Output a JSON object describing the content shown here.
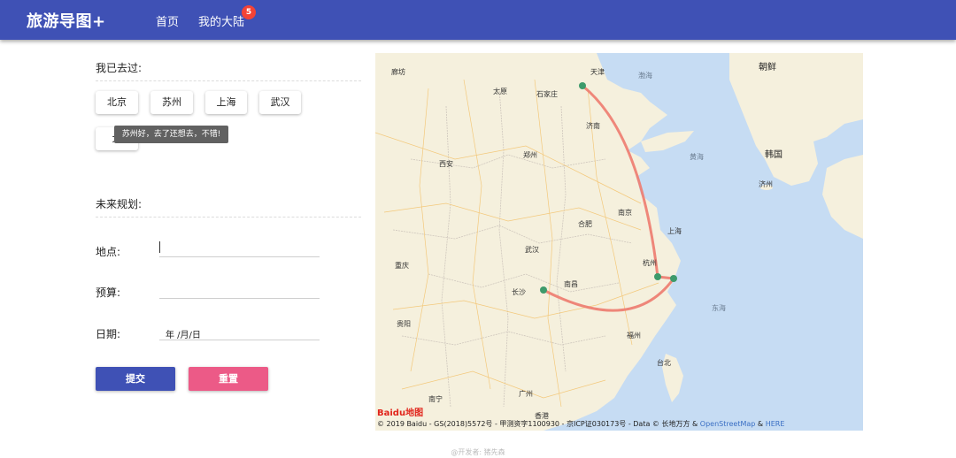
{
  "header": {
    "brand": "旅游导图+",
    "nav_home": "首页",
    "nav_mine": "我的大陆",
    "badge_count": "5"
  },
  "visited": {
    "title": "我已去过:",
    "cities": [
      "北京",
      "苏州",
      "上海",
      "武汉",
      "大"
    ],
    "tooltip": "苏州好，去了还想去，不错!"
  },
  "plan": {
    "title": "未来规划:",
    "location_label": "地点:",
    "budget_label": "预算:",
    "date_label": "日期:",
    "date_placeholder": "年 /月/日"
  },
  "actions": {
    "submit": "提交",
    "reset": "重置"
  },
  "map": {
    "labels": {
      "langfang": "廊坊",
      "tianjin": "天津",
      "bohai": "渤海",
      "chaoxian": "朝鲜",
      "taiyuan": "太原",
      "shijiazhuang": "石家庄",
      "jinan": "济南",
      "hanguo": "韩国",
      "huanghai": "黄海",
      "xian": "西安",
      "zhengzhou": "郑州",
      "nanjing": "南京",
      "hefei": "合肥",
      "shanghai": "上海",
      "wuhan": "武汉",
      "hangzhou": "杭州",
      "chongqing": "重庆",
      "nanchang": "南昌",
      "changsha": "长沙",
      "donghai": "东海",
      "guiyang": "贵阳",
      "fuzhou": "福州",
      "taibei": "台北",
      "nanning": "南宁",
      "guangzhou": "广州",
      "xianggang": "香港",
      "jizhou": "济州"
    },
    "logo": "Baidu地图",
    "attribution": "© 2019 Baidu - GS(2018)5572号 - 甲测资字1100930 - 京ICP证030173号 - Data © 长地万方 & ",
    "osm": "OpenStreetMap",
    "amp": " & ",
    "here": "HERE",
    "colors": {
      "land": "#f5f0dd",
      "water": "#c6dcf3",
      "route": "#ee7b6f",
      "marker": "#3d9a6b"
    }
  },
  "footer": {
    "developer": "@开发者: 猪先森"
  }
}
